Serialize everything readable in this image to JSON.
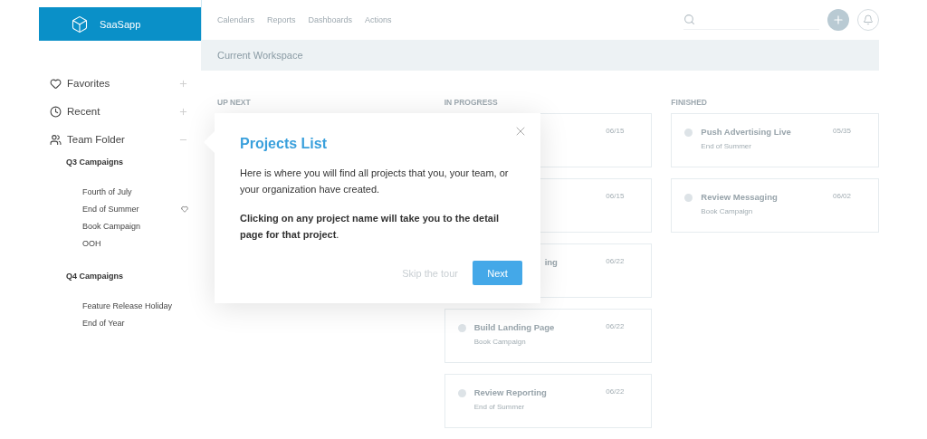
{
  "brand": "SaaSapp",
  "sidebar": {
    "sections": [
      {
        "label": "Favorites",
        "expanded": false
      },
      {
        "label": "Recent",
        "expanded": false
      },
      {
        "label": "Team Folder",
        "expanded": true,
        "children": [
          {
            "label": "Q3 Campaigns",
            "children": [
              {
                "label": "Fourth of July",
                "favorite": false
              },
              {
                "label": "End of Summer",
                "favorite": true
              },
              {
                "label": "Book Campaign",
                "favorite": false
              },
              {
                "label": "OOH",
                "favorite": false
              }
            ]
          },
          {
            "label": "Q4 Campaigns",
            "children": [
              {
                "label": "Feature Release Holiday",
                "favorite": false
              },
              {
                "label": "End of Year",
                "favorite": false
              }
            ]
          }
        ]
      }
    ]
  },
  "nav": {
    "links": [
      "Calendars",
      "Reports",
      "Dashboards",
      "Actions"
    ]
  },
  "workspace_bar": {
    "title": "Current Workspace"
  },
  "columns": [
    {
      "heading": "UP NEXT"
    },
    {
      "heading": "IN PROGRESS",
      "cards": [
        {
          "kind": "covered",
          "date": "06/15"
        },
        {
          "kind": "covered",
          "date": "06/15"
        },
        {
          "kind": "partial",
          "title": "ing",
          "date": "06/22"
        },
        {
          "kind": "full",
          "title": "Build Landing Page",
          "subtitle": "Book Campaign",
          "date": "06/22"
        },
        {
          "kind": "full",
          "title": "Review Reporting",
          "subtitle": "End of Summer",
          "date": "06/22"
        }
      ]
    },
    {
      "heading": "FINISHED",
      "cards": [
        {
          "kind": "full",
          "title": "Push Advertising Live",
          "subtitle": "End of Summer",
          "date": "05/35"
        },
        {
          "kind": "full",
          "title": "Review Messaging",
          "subtitle": "Book Campaign",
          "date": "06/02"
        }
      ]
    }
  ],
  "popover": {
    "title": "Projects List",
    "body": "Here is where you will find all projects that you, your team, or your organization have created.",
    "note": "**Clicking on any project name will take you to the detail page for that project**.",
    "skip": "Skip the tour",
    "next": "Next"
  }
}
